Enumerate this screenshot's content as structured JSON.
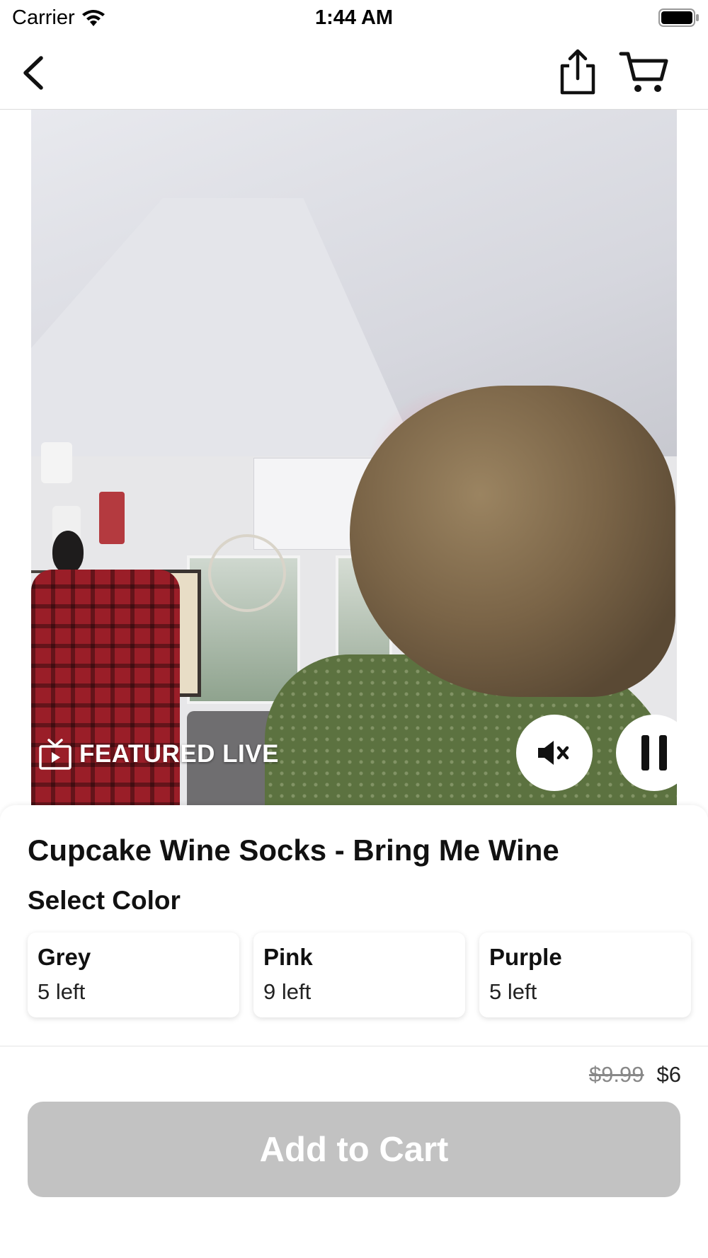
{
  "status_bar": {
    "carrier": "Carrier",
    "time": "1:44 AM",
    "icons": [
      "wifi-icon",
      "battery-icon"
    ]
  },
  "nav_bar": {
    "icons": [
      "back-icon",
      "share-icon",
      "cart-icon"
    ]
  },
  "video": {
    "badge_label": "FEATURED LIVE",
    "badge_icon": "tv-icon",
    "controls": [
      "mute-icon",
      "pause-icon"
    ]
  },
  "product": {
    "title": "Cupcake Wine Socks - Bring Me Wine",
    "select_label": "Select Color",
    "options": [
      {
        "name": "Grey",
        "stock": "5 left"
      },
      {
        "name": "Pink",
        "stock": "9 left"
      },
      {
        "name": "Purple",
        "stock": "5 left"
      }
    ]
  },
  "footer": {
    "original_price": "$9.99",
    "sale_price": "$6",
    "add_to_cart_label": "Add to Cart"
  },
  "colors": {
    "button_disabled": "#c2c2c2",
    "strike_price": "#888888",
    "text": "#111111"
  }
}
